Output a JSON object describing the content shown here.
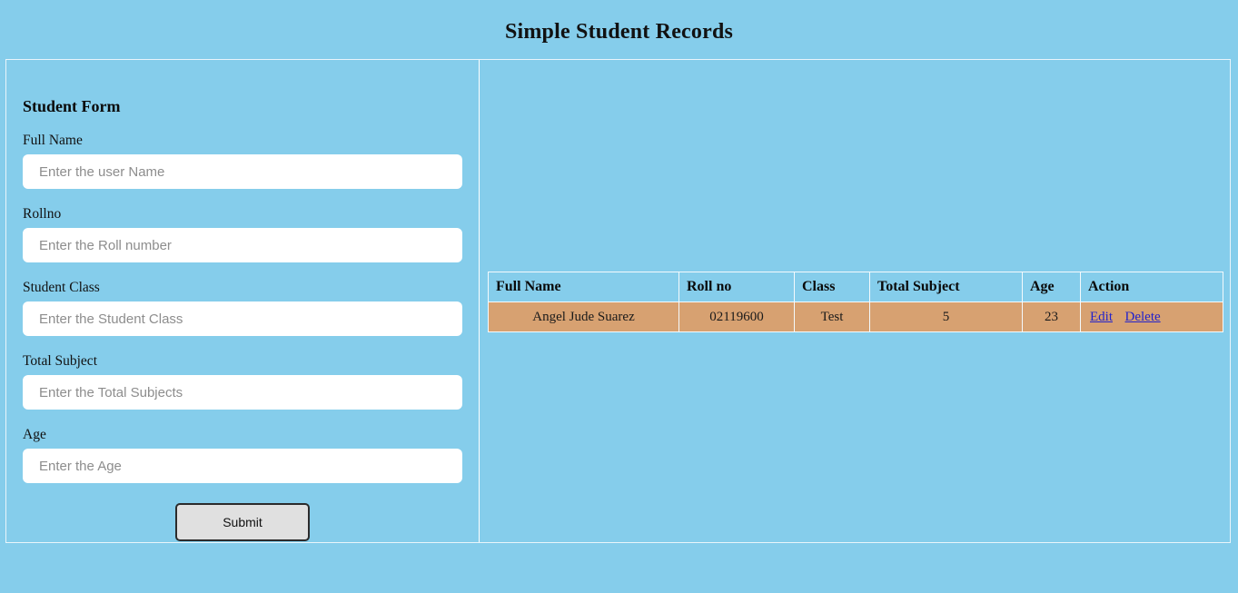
{
  "header": {
    "title": "Simple Student Records"
  },
  "form": {
    "heading": "Student Form",
    "fields": [
      {
        "label": "Full Name",
        "placeholder": "Enter the user Name",
        "value": ""
      },
      {
        "label": "Rollno",
        "placeholder": "Enter the Roll number",
        "value": ""
      },
      {
        "label": "Student Class",
        "placeholder": "Enter the Student Class",
        "value": ""
      },
      {
        "label": "Total Subject",
        "placeholder": "Enter the Total Subjects",
        "value": ""
      },
      {
        "label": "Age",
        "placeholder": "Enter the Age",
        "value": ""
      }
    ],
    "submit_label": "Submit"
  },
  "records": {
    "columns": [
      "Full Name",
      "Roll no",
      "Class",
      "Total Subject",
      "Age",
      "Action"
    ],
    "rows": [
      {
        "full_name": "Angel Jude Suarez",
        "roll_no": "02119600",
        "class": "Test",
        "total_subject": "5",
        "age": "23",
        "edit_label": "Edit",
        "delete_label": "Delete"
      }
    ]
  },
  "colors": {
    "page_background": "#85cdeb",
    "row_background": "#d7a171",
    "link": "#2222cc",
    "button_background": "#e0e0e0"
  }
}
